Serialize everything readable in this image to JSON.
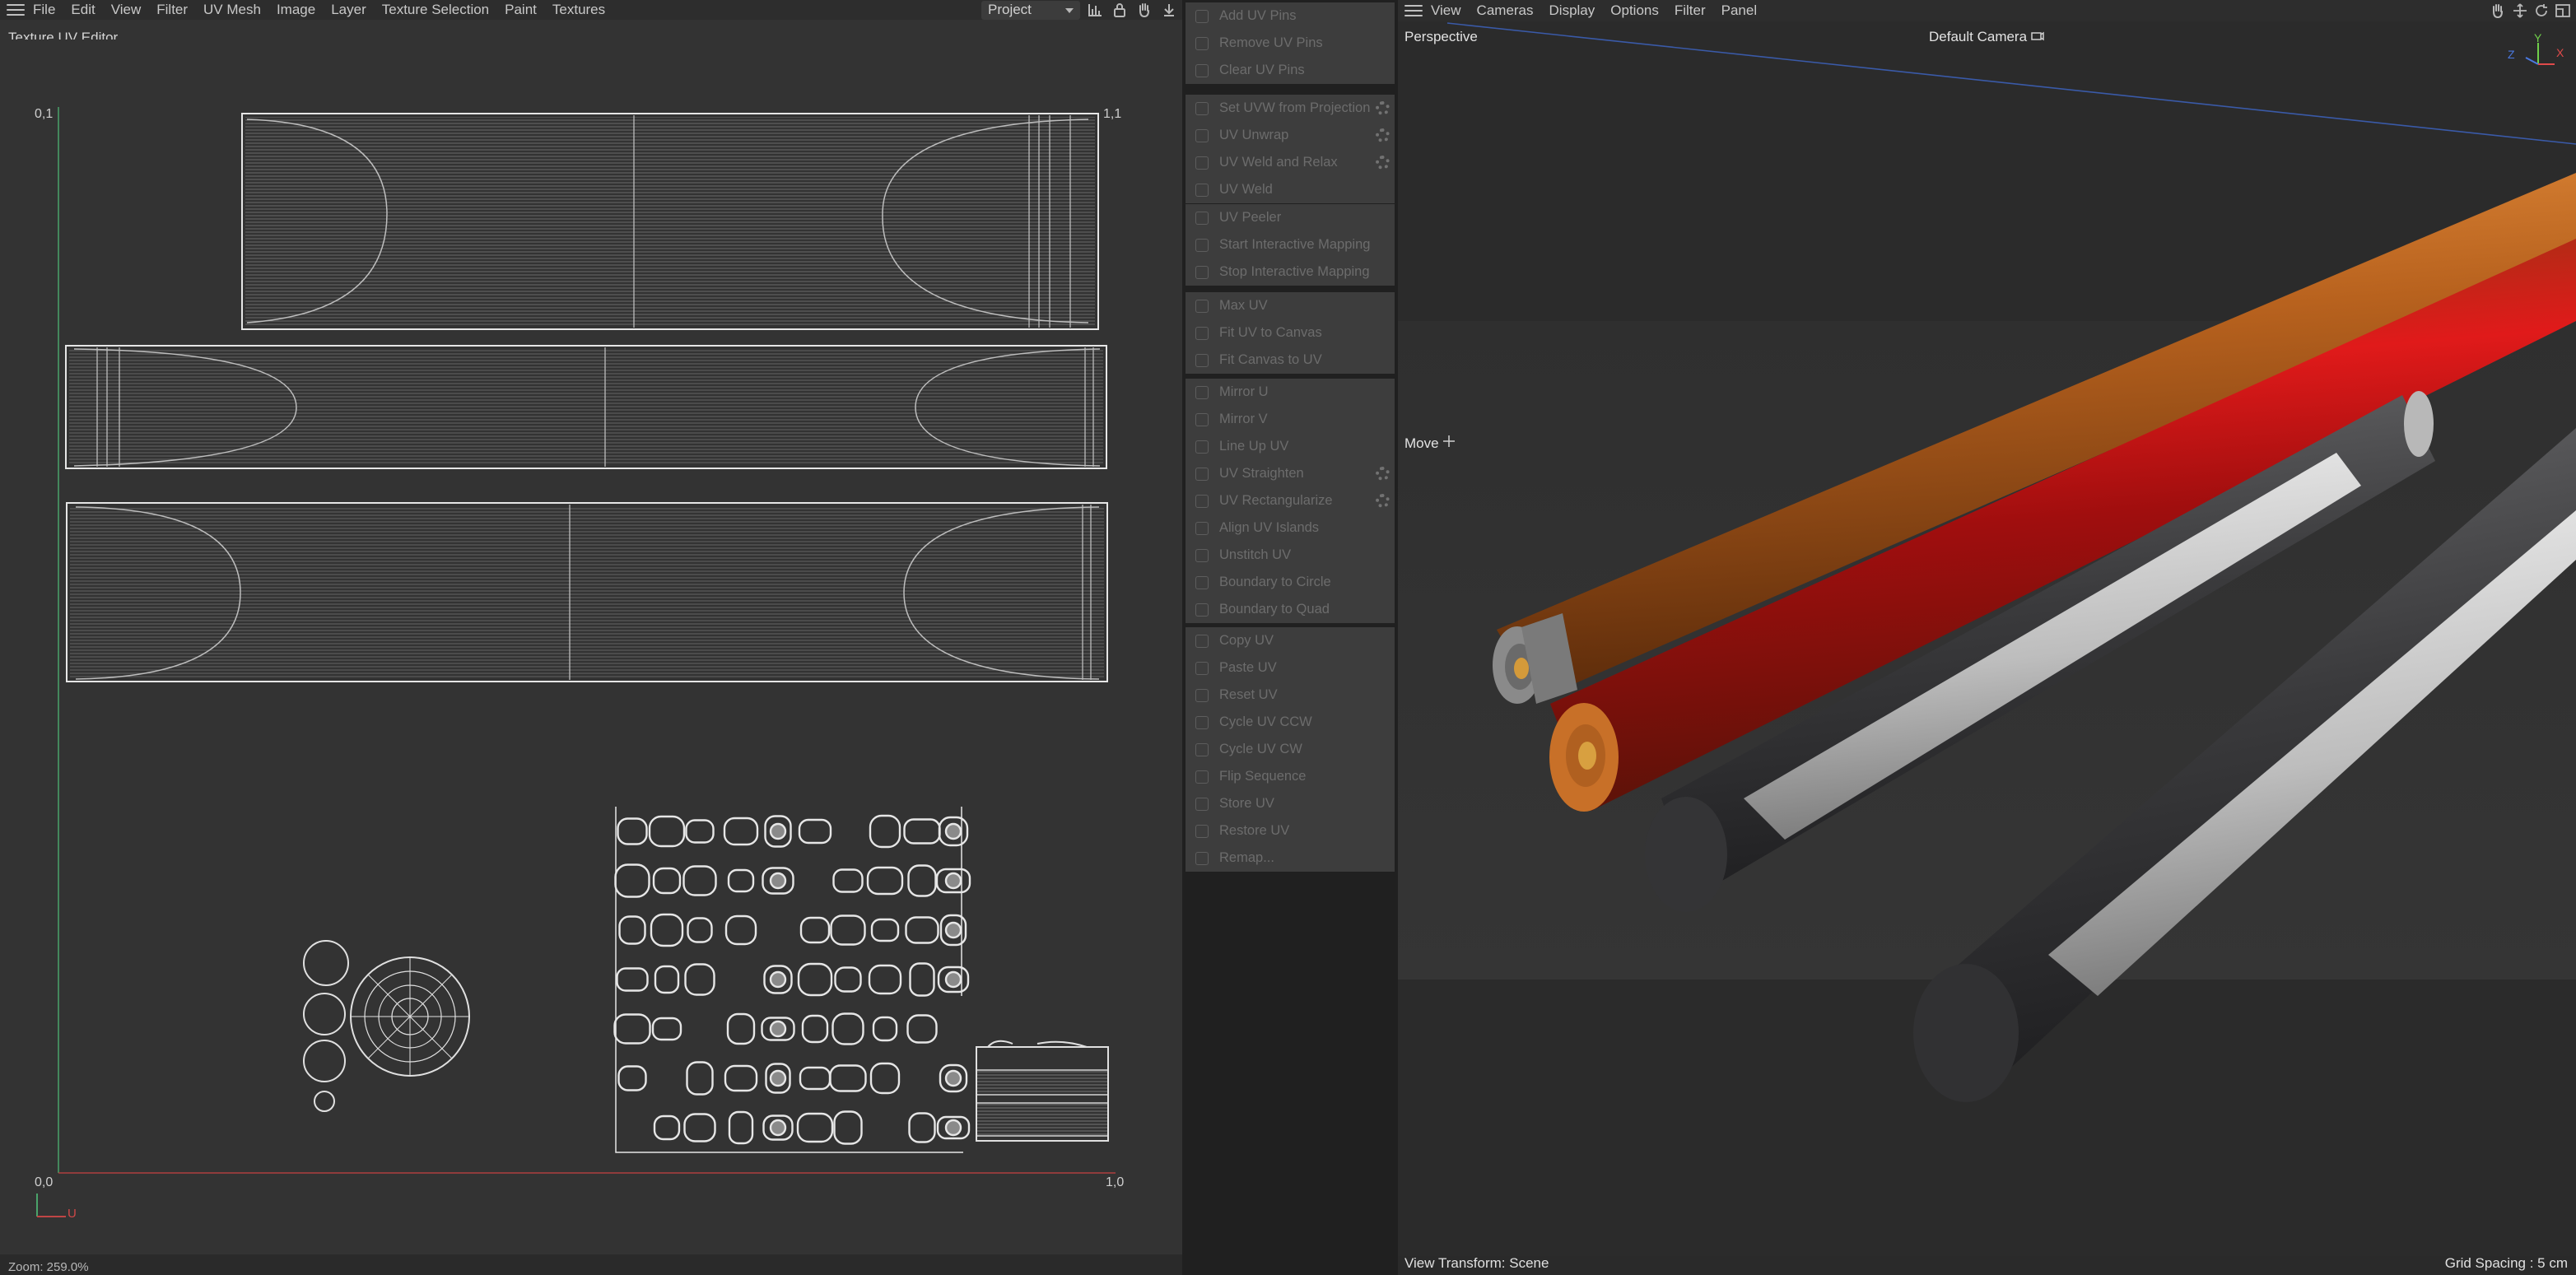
{
  "uv_editor": {
    "menu": [
      "File",
      "Edit",
      "View",
      "Filter",
      "UV Mesh",
      "Image",
      "Layer",
      "Texture Selection",
      "Paint",
      "Textures"
    ],
    "title": "Texture UV Editor",
    "project_select": "Project",
    "corner_labels": {
      "top_left": "0,1",
      "top_right": "1,1",
      "bottom_left": "0,0",
      "bottom_right": "1,0"
    },
    "axis_label": "U",
    "zoom": "Zoom: 259.0%"
  },
  "commands": {
    "groups": [
      [
        {
          "label": "Add UV Pins"
        },
        {
          "label": "Remove UV Pins"
        },
        {
          "label": "Clear UV Pins"
        }
      ],
      [
        {
          "label": "Set UVW from Projection",
          "gear": true
        },
        {
          "label": "UV Unwrap",
          "gear": true
        },
        {
          "label": "UV Weld and Relax",
          "gear": true
        },
        {
          "label": "UV Weld"
        }
      ],
      [
        {
          "label": "UV Peeler"
        },
        {
          "label": "Start Interactive Mapping"
        },
        {
          "label": "Stop Interactive Mapping"
        }
      ],
      [
        {
          "label": "Max UV"
        },
        {
          "label": "Fit UV to Canvas"
        },
        {
          "label": "Fit Canvas to UV"
        }
      ],
      [
        {
          "label": "Mirror U"
        },
        {
          "label": "Mirror V"
        },
        {
          "label": "Line Up UV"
        },
        {
          "label": "UV Straighten",
          "gear": true
        },
        {
          "label": "UV Rectangularize",
          "gear": true
        },
        {
          "label": "Align UV Islands"
        },
        {
          "label": "Unstitch UV"
        },
        {
          "label": "Boundary to Circle"
        },
        {
          "label": "Boundary to Quad"
        }
      ],
      [
        {
          "label": "Copy UV"
        },
        {
          "label": "Paste UV"
        },
        {
          "label": "Reset UV"
        },
        {
          "label": "Cycle UV CCW"
        },
        {
          "label": "Cycle UV CW"
        },
        {
          "label": "Flip Sequence"
        },
        {
          "label": "Store UV"
        },
        {
          "label": "Restore UV"
        },
        {
          "label": "Remap..."
        }
      ]
    ]
  },
  "viewport": {
    "menu": [
      "View",
      "Cameras",
      "Display",
      "Options",
      "Filter",
      "Panel"
    ],
    "perspective": "Perspective",
    "camera": "Default Camera",
    "move": "Move",
    "view_transform": "View Transform: Scene",
    "grid_spacing": "Grid Spacing : 5 cm",
    "axis_labels": {
      "y": "Y",
      "x": "X",
      "z": "Z"
    },
    "colors": {
      "axis_x": "#e04a4a",
      "axis_y": "#6fcf4a",
      "axis_z": "#4a78e0",
      "wood": "#b4601e",
      "red_stripe": "#b01010",
      "carbon": "#3e3e40"
    }
  }
}
